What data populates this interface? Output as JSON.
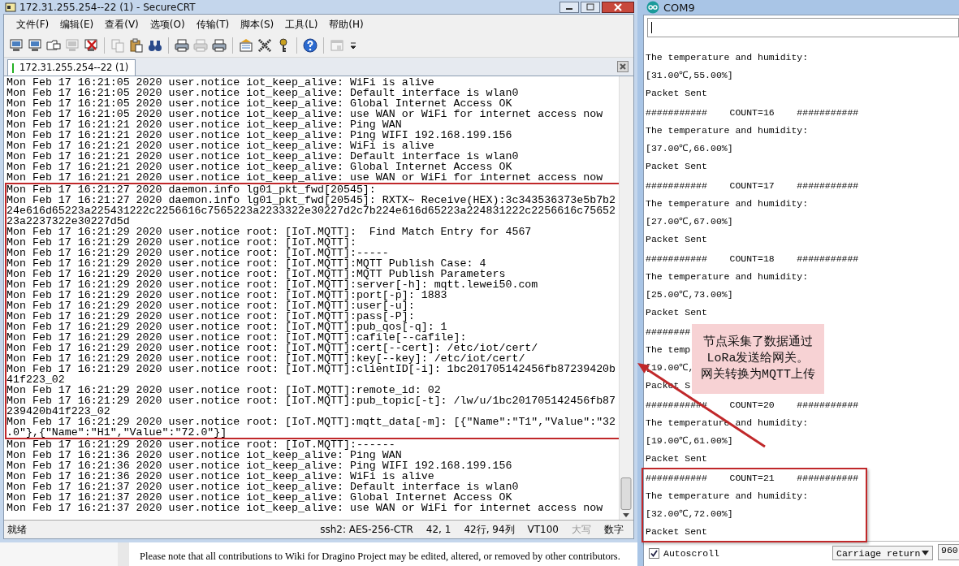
{
  "crt": {
    "title": "172.31.255.254--22 (1) - SecureCRT",
    "menu": [
      "文件(F)",
      "编辑(E)",
      "查看(V)",
      "选项(O)",
      "传输(T)",
      "脚本(S)",
      "工具(L)",
      "帮助(H)"
    ],
    "toolbar": [
      {
        "kind": "computer",
        "disabled": false
      },
      {
        "kind": "computer",
        "disabled": false
      },
      {
        "kind": "folder",
        "disabled": false
      },
      {
        "kind": "computer",
        "disabled": true
      },
      {
        "kind": "computer-x",
        "disabled": false
      },
      {
        "kind": "separator"
      },
      {
        "kind": "copy",
        "disabled": true
      },
      {
        "kind": "paste",
        "disabled": false
      },
      {
        "kind": "find",
        "disabled": false
      },
      {
        "kind": "separator"
      },
      {
        "kind": "print",
        "disabled": false
      },
      {
        "kind": "print",
        "disabled": true
      },
      {
        "kind": "print",
        "disabled": false
      },
      {
        "kind": "separator"
      },
      {
        "kind": "settings",
        "disabled": false
      },
      {
        "kind": "tools",
        "disabled": false
      },
      {
        "kind": "key",
        "disabled": false
      },
      {
        "kind": "separator"
      },
      {
        "kind": "help",
        "disabled": false
      },
      {
        "kind": "separator"
      },
      {
        "kind": "window",
        "disabled": true
      },
      {
        "kind": "overflow"
      }
    ],
    "tabs": [
      {
        "label": "172.31.255.254--22 (1)",
        "selected": true
      }
    ],
    "terminal": {
      "blocks": [
        {
          "highlighted": false,
          "lines": [
            "Mon Feb 17 16:21:05 2020 user.notice iot_keep_alive: WiFi is alive",
            "Mon Feb 17 16:21:05 2020 user.notice iot_keep_alive: Default interface is wlan0",
            "Mon Feb 17 16:21:05 2020 user.notice iot_keep_alive: Global Internet Access OK",
            "Mon Feb 17 16:21:05 2020 user.notice iot_keep_alive: use WAN or WiFi for internet access now",
            "Mon Feb 17 16:21:21 2020 user.notice iot_keep_alive: Ping WAN",
            "Mon Feb 17 16:21:21 2020 user.notice iot_keep_alive: Ping WIFI 192.168.199.156",
            "Mon Feb 17 16:21:21 2020 user.notice iot_keep_alive: WiFi is alive",
            "Mon Feb 17 16:21:21 2020 user.notice iot_keep_alive: Default interface is wlan0",
            "Mon Feb 17 16:21:21 2020 user.notice iot_keep_alive: Global Internet Access OK",
            "Mon Feb 17 16:21:21 2020 user.notice iot_keep_alive: use WAN or WiFi for internet access now"
          ]
        },
        {
          "highlighted": true,
          "lines": [
            "Mon Feb 17 16:21:27 2020 daemon.info lg01_pkt_fwd[20545]:",
            "Mon Feb 17 16:21:27 2020 daemon.info lg01_pkt_fwd[20545]: RXTX~ Receive(HEX):3c343536373e5b7b2",
            "24e616d65223a225431222c2256616c7565223a2233322e30227d2c7b224e616d65223a224831222c2256616c75652",
            "23a2237322e30227d5d",
            "Mon Feb 17 16:21:29 2020 user.notice root: [IoT.MQTT]:  Find Match Entry for 4567",
            "Mon Feb 17 16:21:29 2020 user.notice root: [IoT.MQTT]:",
            "Mon Feb 17 16:21:29 2020 user.notice root: [IoT.MQTT]:-----",
            "Mon Feb 17 16:21:29 2020 user.notice root: [IoT.MQTT]:MQTT Publish Case: 4",
            "Mon Feb 17 16:21:29 2020 user.notice root: [IoT.MQTT]:MQTT Publish Parameters",
            "Mon Feb 17 16:21:29 2020 user.notice root: [IoT.MQTT]:server[-h]: mqtt.lewei50.com",
            "Mon Feb 17 16:21:29 2020 user.notice root: [IoT.MQTT]:port[-p]: 1883",
            "Mon Feb 17 16:21:29 2020 user.notice root: [IoT.MQTT]:user[-u]:",
            "Mon Feb 17 16:21:29 2020 user.notice root: [IoT.MQTT]:pass[-P]:",
            "Mon Feb 17 16:21:29 2020 user.notice root: [IoT.MQTT]:pub_qos[-q]: 1",
            "Mon Feb 17 16:21:29 2020 user.notice root: [IoT.MQTT]:cafile[--cafile]:",
            "Mon Feb 17 16:21:29 2020 user.notice root: [IoT.MQTT]:cert[--cert]: /etc/iot/cert/",
            "Mon Feb 17 16:21:29 2020 user.notice root: [IoT.MQTT]:key[--key]: /etc/iot/cert/",
            "Mon Feb 17 16:21:29 2020 user.notice root: [IoT.MQTT]:clientID[-i]: 1bc201705142456fb87239420b",
            "41f223_02",
            "Mon Feb 17 16:21:29 2020 user.notice root: [IoT.MQTT]:remote_id: 02",
            "Mon Feb 17 16:21:29 2020 user.notice root: [IoT.MQTT]:pub_topic[-t]: /lw/u/1bc201705142456fb87",
            "239420b41f223_02",
            "Mon Feb 17 16:21:29 2020 user.notice root: [IoT.MQTT]:mqtt_data[-m]: [{\"Name\":\"T1\",\"Value\":\"32",
            ".0\"},{\"Name\":\"H1\",\"Value\":\"72.0\"}]"
          ]
        },
        {
          "highlighted": false,
          "lines": [
            "Mon Feb 17 16:21:29 2020 user.notice root: [IoT.MQTT]:------",
            "Mon Feb 17 16:21:36 2020 user.notice iot_keep_alive: Ping WAN",
            "Mon Feb 17 16:21:36 2020 user.notice iot_keep_alive: Ping WIFI 192.168.199.156",
            "Mon Feb 17 16:21:36 2020 user.notice iot_keep_alive: WiFi is alive",
            "Mon Feb 17 16:21:37 2020 user.notice iot_keep_alive: Default interface is wlan0",
            "Mon Feb 17 16:21:37 2020 user.notice iot_keep_alive: Global Internet Access OK",
            "Mon Feb 17 16:21:37 2020 user.notice iot_keep_alive: use WAN or WiFi for internet access now"
          ]
        }
      ]
    },
    "status_bar": {
      "message": "就绪",
      "panes": [
        {
          "text": "ssh2: AES-256-CTR",
          "disabled": false
        },
        {
          "text": "42,  1",
          "disabled": false
        },
        {
          "text": "42行, 94列",
          "disabled": false
        },
        {
          "text": "VT100",
          "disabled": false
        },
        {
          "text": "大写",
          "disabled": true
        },
        {
          "text": "数字",
          "disabled": false
        }
      ]
    }
  },
  "wiki_notice": "Please note that all contributions to Wiki for Dragino Project may be edited, altered, or removed by other contributors.",
  "com": {
    "title": "COM9",
    "blocks": [
      {
        "highlighted": false,
        "lines": [
          "The temperature and humidity:",
          "[31.00℃,55.00%]",
          "Packet Sent"
        ]
      },
      {
        "highlighted": false,
        "lines": [
          "###########    COUNT=16    ###########",
          "The temperature and humidity:",
          "[37.00℃,66.00%]",
          "Packet Sent"
        ]
      },
      {
        "highlighted": false,
        "lines": [
          "###########    COUNT=17    ###########",
          "The temperature and humidity:",
          "[27.00℃,67.00%]",
          "Packet Sent"
        ]
      },
      {
        "highlighted": false,
        "lines": [
          "###########    COUNT=18    ###########",
          "The temperature and humidity:",
          "[25.00℃,73.00%]",
          "Packet Sent"
        ]
      },
      {
        "highlighted": false,
        "lines": [
          "########",
          "The temp",
          "[19.00℃,",
          "Packet S"
        ]
      },
      {
        "highlighted": false,
        "lines": [
          "###########    COUNT=20    ###########",
          "The temperature and humidity:",
          "[19.00℃,61.00%]",
          "Packet Sent"
        ]
      },
      {
        "highlighted": true,
        "lines": [
          "###########    COUNT=21    ###########",
          "The temperature and humidity:",
          "[32.00℃,72.00%]",
          "Packet Sent"
        ]
      }
    ],
    "callout": [
      "节点采集了数据通过",
      "LoRa发送给网关。",
      "网关转换为MQTT上传"
    ],
    "autoscroll": {
      "label": "Autoscroll",
      "checked": true
    },
    "line_ending": "Carriage return",
    "baud": "960"
  }
}
